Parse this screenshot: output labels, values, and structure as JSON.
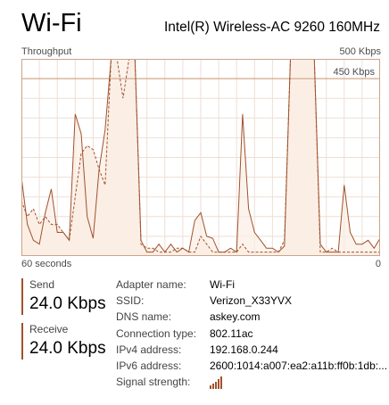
{
  "header": {
    "title": "Wi-Fi",
    "adapter_name": "Intel(R) Wireless-AC 9260 160MHz"
  },
  "graph": {
    "label_top_left": "Throughput",
    "label_top_right": "500 Kbps",
    "label_scale": "450 Kbps",
    "label_bottom_left": "60 seconds",
    "label_bottom_right": "0"
  },
  "chart_data": {
    "type": "area",
    "xlim": [
      60,
      0
    ],
    "ylim": [
      0,
      500
    ],
    "x_unit": "seconds ago",
    "y_unit": "Kbps",
    "series": [
      {
        "values": [
          200,
          80,
          40,
          30,
          110,
          170,
          60,
          60,
          40,
          360,
          310,
          100,
          45,
          220,
          320,
          500,
          500,
          500,
          500,
          500,
          40,
          10,
          10,
          30,
          10,
          30,
          10,
          20,
          10,
          90,
          110,
          50,
          45,
          10,
          10,
          20,
          10,
          360,
          120,
          60,
          40,
          20,
          20,
          10,
          25,
          500,
          500,
          500,
          500,
          500,
          30,
          10,
          10,
          10,
          180,
          60,
          30,
          30,
          40,
          20,
          45
        ]
      },
      {
        "values": [
          140,
          100,
          120,
          80,
          100,
          80,
          80,
          60,
          40,
          150,
          260,
          280,
          270,
          220,
          180,
          500,
          500,
          400,
          500,
          500,
          30,
          20,
          20,
          10,
          10,
          10,
          20,
          20,
          10,
          10,
          50,
          30,
          10,
          10,
          10,
          10,
          10,
          30,
          10,
          10,
          10,
          10,
          10,
          10,
          40,
          500,
          500,
          500,
          500,
          500,
          10,
          10,
          20,
          10,
          10,
          10,
          10,
          10,
          10,
          10,
          10
        ]
      }
    ]
  },
  "send": {
    "label": "Send",
    "value": "24.0 Kbps"
  },
  "receive": {
    "label": "Receive",
    "value": "24.0 Kbps"
  },
  "details": [
    {
      "key": "Adapter name:",
      "value": "Wi-Fi"
    },
    {
      "key": "SSID:",
      "value": "Verizon_X33YVX"
    },
    {
      "key": "DNS name:",
      "value": "askey.com"
    },
    {
      "key": "Connection type:",
      "value": "802.11ac"
    },
    {
      "key": "IPv4 address:",
      "value": "192.168.0.244"
    },
    {
      "key": "IPv6 address:",
      "value": "2600:1014:a007:ea2:a11b:ff0b:1db:..."
    },
    {
      "key": "Signal strength:",
      "value": ""
    }
  ],
  "colors": {
    "accent": "#a0522d",
    "graph_border": "#c9a48b",
    "graph_grid": "#eedfd4",
    "graph_fill": "#fbeee5",
    "scale_line": "#c79a7c"
  },
  "icons": {
    "signal": "signal-strength-bars-icon"
  }
}
